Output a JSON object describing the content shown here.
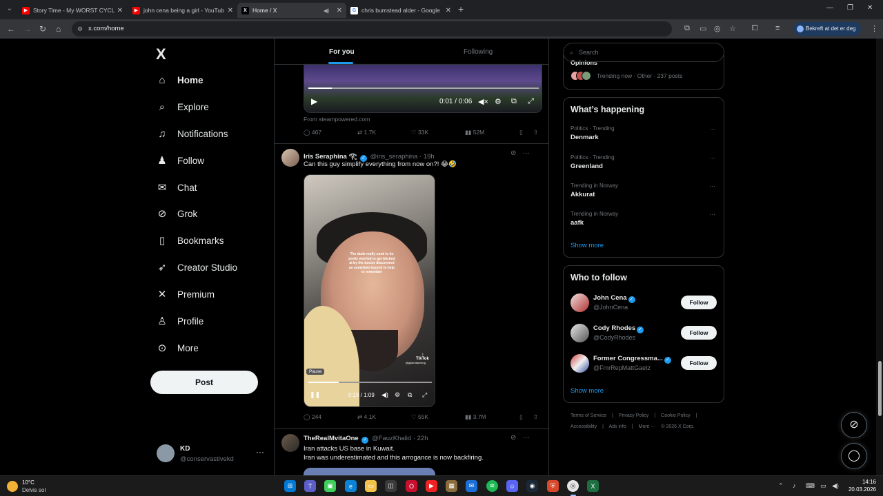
{
  "browser": {
    "tabs": [
      {
        "title": "Story Time - My WORST CYCLE",
        "favicon": "youtube-icon",
        "color": "#ff0000",
        "active": false
      },
      {
        "title": "john cena being a girl - YouTub",
        "favicon": "youtube-icon",
        "color": "#ff0000",
        "active": false
      },
      {
        "title": "Home / X",
        "favicon": "x-icon",
        "color": "#000000",
        "active": true
      },
      {
        "title": "chris bumstead alder - Google",
        "favicon": "google-icon",
        "color": "#4285f4",
        "active": false
      }
    ],
    "url": "x.com/home",
    "profile_label": "Bekreft at det er deg"
  },
  "sidebar": {
    "items": [
      {
        "label": "Home",
        "icon": "home-icon",
        "glyph": "⌂"
      },
      {
        "label": "Explore",
        "icon": "search-icon",
        "glyph": "⌕"
      },
      {
        "label": "Notifications",
        "icon": "bell-icon",
        "glyph": "♫"
      },
      {
        "label": "Follow",
        "icon": "person-add-icon",
        "glyph": "♟"
      },
      {
        "label": "Chat",
        "icon": "mail-icon",
        "glyph": "✉"
      },
      {
        "label": "Grok",
        "icon": "grok-icon",
        "glyph": "⊘"
      },
      {
        "label": "Bookmarks",
        "icon": "bookmark-icon",
        "glyph": "▯"
      },
      {
        "label": "Creator Studio",
        "icon": "rocket-icon",
        "glyph": "➶"
      },
      {
        "label": "Premium",
        "icon": "x-premium-icon",
        "glyph": "✕"
      },
      {
        "label": "Profile",
        "icon": "profile-icon",
        "glyph": "♙"
      },
      {
        "label": "More",
        "icon": "more-circle-icon",
        "glyph": "⊙"
      }
    ],
    "post_button": "Post",
    "account": {
      "name": "KD",
      "handle": "@conservastivekd"
    }
  },
  "timeline": {
    "tabs": {
      "for_you": "For you",
      "following": "Following"
    },
    "tweet1": {
      "video_time": "0:01 / 0:06",
      "source": "From steampowered.com",
      "replies": "467",
      "reposts": "1.7K",
      "likes": "33K",
      "views": "52M"
    },
    "tweet2": {
      "name": "Iris Seraphina 𓂀",
      "handle": "@iris_seraphina",
      "time": "19h",
      "text": "Can this guy simplify everything from now on?! 😂🤣",
      "video_caption": "The dude really used to be pretty worried to get bitched at by the doctor discovered as somehow buzzed to help to remember",
      "tiktok_label": "TikTok",
      "tiktok_handle": "@gtiamdacheng",
      "pause_label": "Pause",
      "video_time": "0:18 / 1:09",
      "replies": "244",
      "reposts": "4.1K",
      "likes": "55K",
      "views": "3.7M"
    },
    "tweet3": {
      "name": "TheRealMvitaOne",
      "handle": "@FauzKhalid",
      "time": "22h",
      "line1": "Iran attacks US base in Kuwait.",
      "line2": "Iran was underestimated and this arrogance is now backfiring."
    }
  },
  "right": {
    "search_placeholder": "Search",
    "top_trend": {
      "title": "Opinions",
      "meta": "Trending now · Other · 237 posts"
    },
    "whats_happening": {
      "title": "What’s happening",
      "trends": [
        {
          "context": "Politics · Trending",
          "name": "Denmark"
        },
        {
          "context": "Politics · Trending",
          "name": "Greenland"
        },
        {
          "context": "Trending in Norway",
          "name": "Akkurat"
        },
        {
          "context": "Trending in Norway",
          "name": "aafk"
        }
      ],
      "show_more": "Show more"
    },
    "who_to_follow": {
      "title": "Who to follow",
      "accounts": [
        {
          "name": "John Cena",
          "handle": "@JohnCena",
          "button": "Follow"
        },
        {
          "name": "Cody Rhodes",
          "handle": "@CodyRhodes",
          "button": "Follow"
        },
        {
          "name": "Former Congressma...",
          "handle": "@FmrRepMattGaetz",
          "button": "Follow"
        }
      ],
      "show_more": "Show more"
    },
    "footer": {
      "line1": [
        "Terms of Service",
        "|",
        "Privacy Policy",
        "|",
        "Cookie Policy",
        "|"
      ],
      "line2": [
        "Accessibility",
        "|",
        "Ads info",
        "|",
        "More ···",
        "© 2026 X Corp."
      ]
    }
  },
  "taskbar": {
    "temperature": "10°C",
    "condition": "Delvis sol",
    "time": "14:16",
    "date": "20.03.2026"
  },
  "colors": {
    "accent": "#1d9bf0",
    "background": "#000000",
    "border": "#2f3336",
    "muted": "#71767b"
  }
}
